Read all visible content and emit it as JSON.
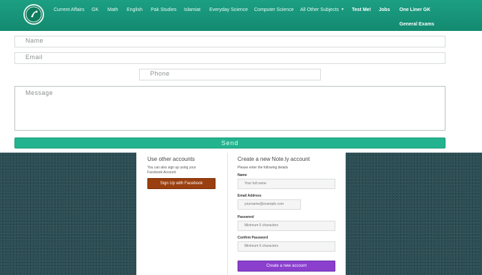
{
  "nav": {
    "links": [
      {
        "label": "Current Affairs"
      },
      {
        "label": "GK"
      },
      {
        "label": "Math"
      },
      {
        "label": "English"
      },
      {
        "label": "Pak Studies"
      },
      {
        "label": "Islamiat"
      },
      {
        "label": "Everyday Science"
      },
      {
        "label": "Computer Science"
      },
      {
        "label": "All Other Subjects"
      },
      {
        "label": "Test Me!"
      },
      {
        "label": "Jobs"
      },
      {
        "label": "One Liner GK"
      },
      {
        "label": "General Exams"
      }
    ]
  },
  "contact_form": {
    "name_placeholder": "Name",
    "email_placeholder": "Email",
    "phone_placeholder": "Phone",
    "message_placeholder": "Message",
    "send_label": "Send"
  },
  "other_accounts": {
    "title": "Use other accounts",
    "line1": "You can also sign up using your",
    "line2": "Facebook Account",
    "facebook_button": "Sign Up with Facebook"
  },
  "register": {
    "title": "Create a new Note.ly account",
    "intro": "Please enter the following details",
    "name_label": "Name",
    "name_placeholder": "Your full name",
    "email_label": "Email Address",
    "email_placeholder": "yourname@example.com",
    "password_label": "Password",
    "password_placeholder": "Minimum 6 characters",
    "confirm_label": "Confirm Password",
    "confirm_placeholder": "Minimum 6 characters",
    "create_button": "Create a new account"
  },
  "colors": {
    "header": "#1c9f83",
    "send_button": "#23b48f",
    "facebook_button": "#9a3f0f",
    "create_button": "#8a3fcd"
  }
}
